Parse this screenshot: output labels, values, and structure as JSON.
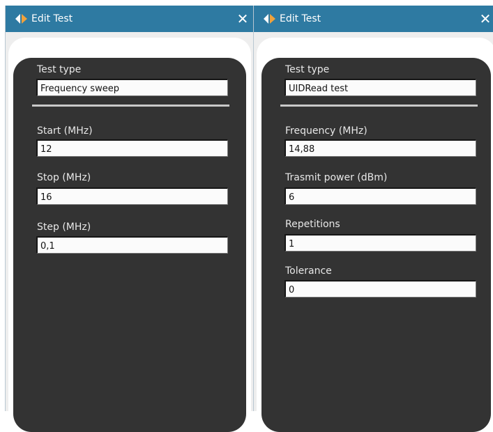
{
  "windows": [
    {
      "title": "Edit Test",
      "close_glyph": "✕",
      "test_type": {
        "label": "Test type",
        "value": "Frequency sweep"
      },
      "fields": [
        {
          "label": "Start (MHz)",
          "value": "12"
        },
        {
          "label": "Stop (MHz)",
          "value": "16"
        },
        {
          "label": "Step (MHz)",
          "value": "0,1"
        }
      ]
    },
    {
      "title": "Edit Test",
      "close_glyph": "✕",
      "test_type": {
        "label": "Test type",
        "value": "UIDRead test"
      },
      "fields": [
        {
          "label": "Frequency (MHz)",
          "value": "14,88"
        },
        {
          "label": "Trasmit power (dBm)",
          "value": "6"
        },
        {
          "label": "Repetitions",
          "value": "1"
        },
        {
          "label": "Tolerance",
          "value": "0"
        }
      ]
    }
  ],
  "colors": {
    "titlebar": "#2e7aa2",
    "panel": "#333333",
    "label_text": "#e8e8e8",
    "field_bg": "#fbfbfb",
    "divider": "#c9c9c9"
  },
  "icons": {
    "app": "app-logo-icon",
    "close": "close-icon"
  }
}
